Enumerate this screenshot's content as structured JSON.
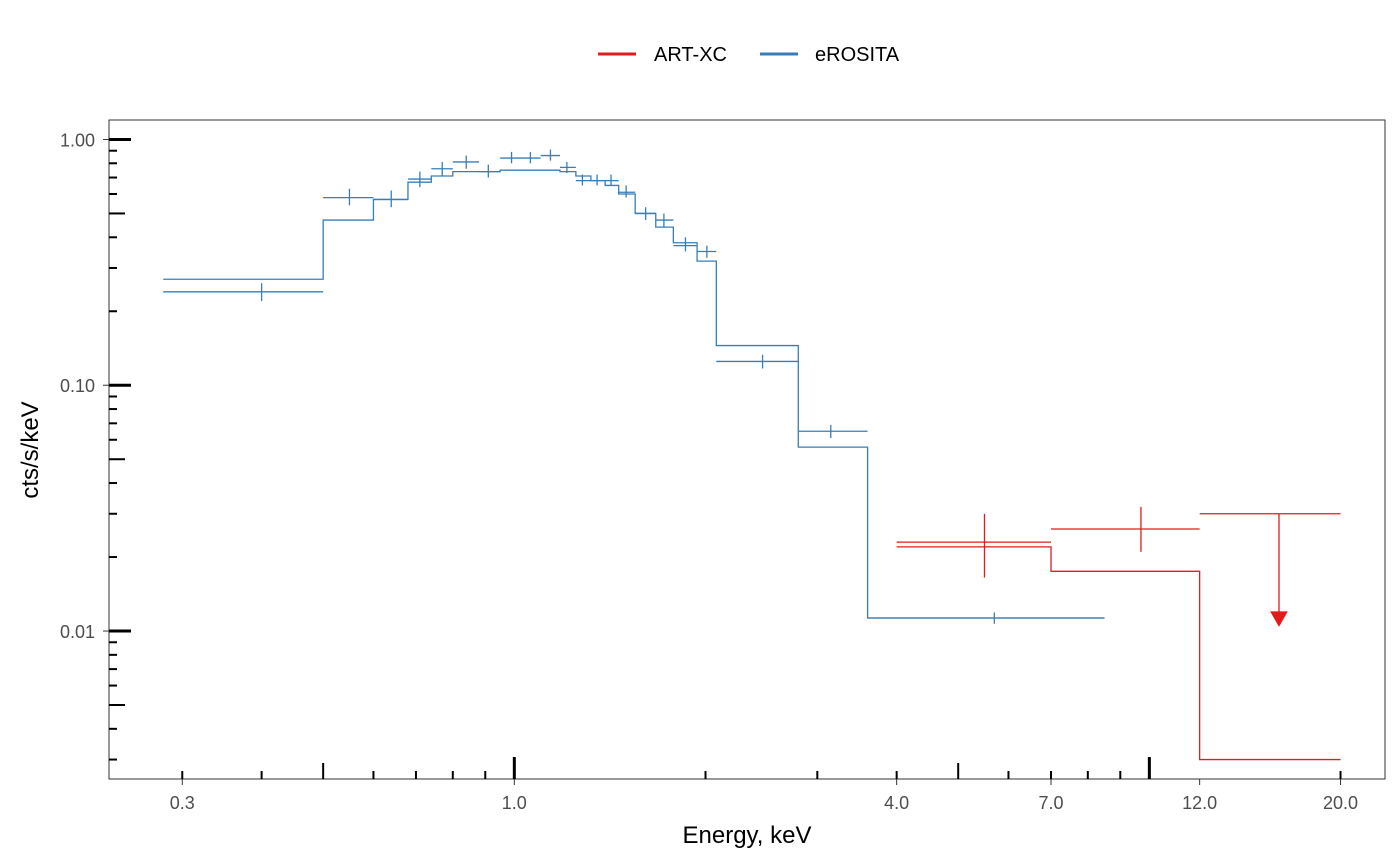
{
  "chart_data": {
    "type": "line",
    "title": "",
    "xlabel": "Energy, keV",
    "ylabel": "cts/s/keV",
    "x_scale": "log",
    "y_scale": "log",
    "xlim": [
      0.23,
      23.5
    ],
    "ylim": [
      0.0025,
      1.2
    ],
    "x_ticks": [
      {
        "value": 0.3,
        "label": "0.3"
      },
      {
        "value": 1.0,
        "label": "1.0"
      },
      {
        "value": 4.0,
        "label": "4.0"
      },
      {
        "value": 7.0,
        "label": "7.0"
      },
      {
        "value": 12.0,
        "label": "12.0"
      },
      {
        "value": 20.0,
        "label": "20.0"
      }
    ],
    "y_ticks": [
      {
        "value": 1.0,
        "label": "1.00"
      },
      {
        "value": 0.1,
        "label": "0.10"
      },
      {
        "value": 0.01,
        "label": "0.01"
      }
    ],
    "legend": {
      "position": "top",
      "entries": [
        {
          "name": "ART-XC",
          "color": "#e41a1c"
        },
        {
          "name": "eROSITA",
          "color": "#377eb8"
        }
      ]
    },
    "grid": false,
    "series": [
      {
        "name": "eROSITA",
        "color": "#377eb8",
        "data": [
          {
            "x": 0.4,
            "xlo": 0.28,
            "xhi": 0.5,
            "y": 0.24,
            "ylo": 0.22,
            "yhi": 0.26
          },
          {
            "x": 0.55,
            "xlo": 0.5,
            "xhi": 0.6,
            "y": 0.58,
            "ylo": 0.54,
            "yhi": 0.63
          },
          {
            "x": 0.64,
            "xlo": 0.6,
            "xhi": 0.68,
            "y": 0.57,
            "ylo": 0.53,
            "yhi": 0.62
          },
          {
            "x": 0.71,
            "xlo": 0.68,
            "xhi": 0.74,
            "y": 0.69,
            "ylo": 0.64,
            "yhi": 0.74
          },
          {
            "x": 0.77,
            "xlo": 0.74,
            "xhi": 0.8,
            "y": 0.76,
            "ylo": 0.71,
            "yhi": 0.81
          },
          {
            "x": 0.84,
            "xlo": 0.8,
            "xhi": 0.88,
            "y": 0.81,
            "ylo": 0.76,
            "yhi": 0.86
          },
          {
            "x": 0.91,
            "xlo": 0.88,
            "xhi": 0.95,
            "y": 0.74,
            "ylo": 0.7,
            "yhi": 0.79
          },
          {
            "x": 0.99,
            "xlo": 0.95,
            "xhi": 1.03,
            "y": 0.84,
            "ylo": 0.8,
            "yhi": 0.89
          },
          {
            "x": 1.06,
            "xlo": 1.03,
            "xhi": 1.1,
            "y": 0.84,
            "ylo": 0.8,
            "yhi": 0.89
          },
          {
            "x": 1.14,
            "xlo": 1.1,
            "xhi": 1.18,
            "y": 0.86,
            "ylo": 0.82,
            "yhi": 0.91
          },
          {
            "x": 1.21,
            "xlo": 1.18,
            "xhi": 1.25,
            "y": 0.77,
            "ylo": 0.73,
            "yhi": 0.81
          },
          {
            "x": 1.28,
            "xlo": 1.25,
            "xhi": 1.32,
            "y": 0.68,
            "ylo": 0.65,
            "yhi": 0.72
          },
          {
            "x": 1.35,
            "xlo": 1.32,
            "xhi": 1.39,
            "y": 0.68,
            "ylo": 0.65,
            "yhi": 0.72
          },
          {
            "x": 1.42,
            "xlo": 1.39,
            "xhi": 1.46,
            "y": 0.68,
            "ylo": 0.65,
            "yhi": 0.72
          },
          {
            "x": 1.5,
            "xlo": 1.46,
            "xhi": 1.55,
            "y": 0.61,
            "ylo": 0.58,
            "yhi": 0.65
          },
          {
            "x": 1.61,
            "xlo": 1.55,
            "xhi": 1.67,
            "y": 0.5,
            "ylo": 0.47,
            "yhi": 0.53
          },
          {
            "x": 1.72,
            "xlo": 1.67,
            "xhi": 1.78,
            "y": 0.47,
            "ylo": 0.44,
            "yhi": 0.5
          },
          {
            "x": 1.86,
            "xlo": 1.78,
            "xhi": 1.94,
            "y": 0.37,
            "ylo": 0.35,
            "yhi": 0.4
          },
          {
            "x": 2.01,
            "xlo": 1.94,
            "xhi": 2.08,
            "y": 0.35,
            "ylo": 0.33,
            "yhi": 0.37
          },
          {
            "x": 2.46,
            "xlo": 2.08,
            "xhi": 2.8,
            "y": 0.125,
            "ylo": 0.117,
            "yhi": 0.133
          },
          {
            "x": 3.15,
            "xlo": 2.8,
            "xhi": 3.6,
            "y": 0.065,
            "ylo": 0.061,
            "yhi": 0.069
          },
          {
            "x": 5.7,
            "xlo": 3.6,
            "xhi": 8.5,
            "y": 0.0113,
            "ylo": 0.0107,
            "yhi": 0.0119
          }
        ],
        "model_steps": [
          {
            "x0": 0.28,
            "x1": 0.5,
            "y": 0.27
          },
          {
            "x0": 0.5,
            "x1": 0.6,
            "y": 0.47
          },
          {
            "x0": 0.6,
            "x1": 0.68,
            "y": 0.57
          },
          {
            "x0": 0.68,
            "x1": 0.74,
            "y": 0.67
          },
          {
            "x0": 0.74,
            "x1": 0.8,
            "y": 0.71
          },
          {
            "x0": 0.8,
            "x1": 0.88,
            "y": 0.74
          },
          {
            "x0": 0.88,
            "x1": 0.95,
            "y": 0.74
          },
          {
            "x0": 0.95,
            "x1": 1.03,
            "y": 0.75
          },
          {
            "x0": 1.03,
            "x1": 1.1,
            "y": 0.75
          },
          {
            "x0": 1.1,
            "x1": 1.18,
            "y": 0.75
          },
          {
            "x0": 1.18,
            "x1": 1.25,
            "y": 0.74
          },
          {
            "x0": 1.25,
            "x1": 1.32,
            "y": 0.71
          },
          {
            "x0": 1.32,
            "x1": 1.39,
            "y": 0.68
          },
          {
            "x0": 1.39,
            "x1": 1.46,
            "y": 0.65
          },
          {
            "x0": 1.46,
            "x1": 1.55,
            "y": 0.6
          },
          {
            "x0": 1.55,
            "x1": 1.67,
            "y": 0.5
          },
          {
            "x0": 1.67,
            "x1": 1.78,
            "y": 0.44
          },
          {
            "x0": 1.78,
            "x1": 1.94,
            "y": 0.38
          },
          {
            "x0": 1.94,
            "x1": 2.08,
            "y": 0.32
          },
          {
            "x0": 2.08,
            "x1": 2.8,
            "y": 0.145
          },
          {
            "x0": 2.8,
            "x1": 3.6,
            "y": 0.056
          },
          {
            "x0": 3.6,
            "x1": 8.5,
            "y": 0.0113
          }
        ]
      },
      {
        "name": "ART-XC",
        "color": "#e41a1c",
        "data": [
          {
            "x": 5.5,
            "xlo": 4.0,
            "xhi": 7.0,
            "y": 0.023,
            "ylo": 0.0165,
            "yhi": 0.03
          },
          {
            "x": 9.7,
            "xlo": 7.0,
            "xhi": 12.0,
            "y": 0.026,
            "ylo": 0.021,
            "yhi": 0.032
          },
          {
            "x": 16.0,
            "xlo": 12.0,
            "xhi": 20.0,
            "y": 0.03,
            "upper_limit": true,
            "arrow_to": 0.0105
          }
        ],
        "model_steps": [
          {
            "x0": 4.0,
            "x1": 7.0,
            "y": 0.022
          },
          {
            "x0": 7.0,
            "x1": 12.0,
            "y": 0.0175
          },
          {
            "x0": 12.0,
            "x1": 20.0,
            "y": 0.003
          }
        ]
      }
    ]
  }
}
